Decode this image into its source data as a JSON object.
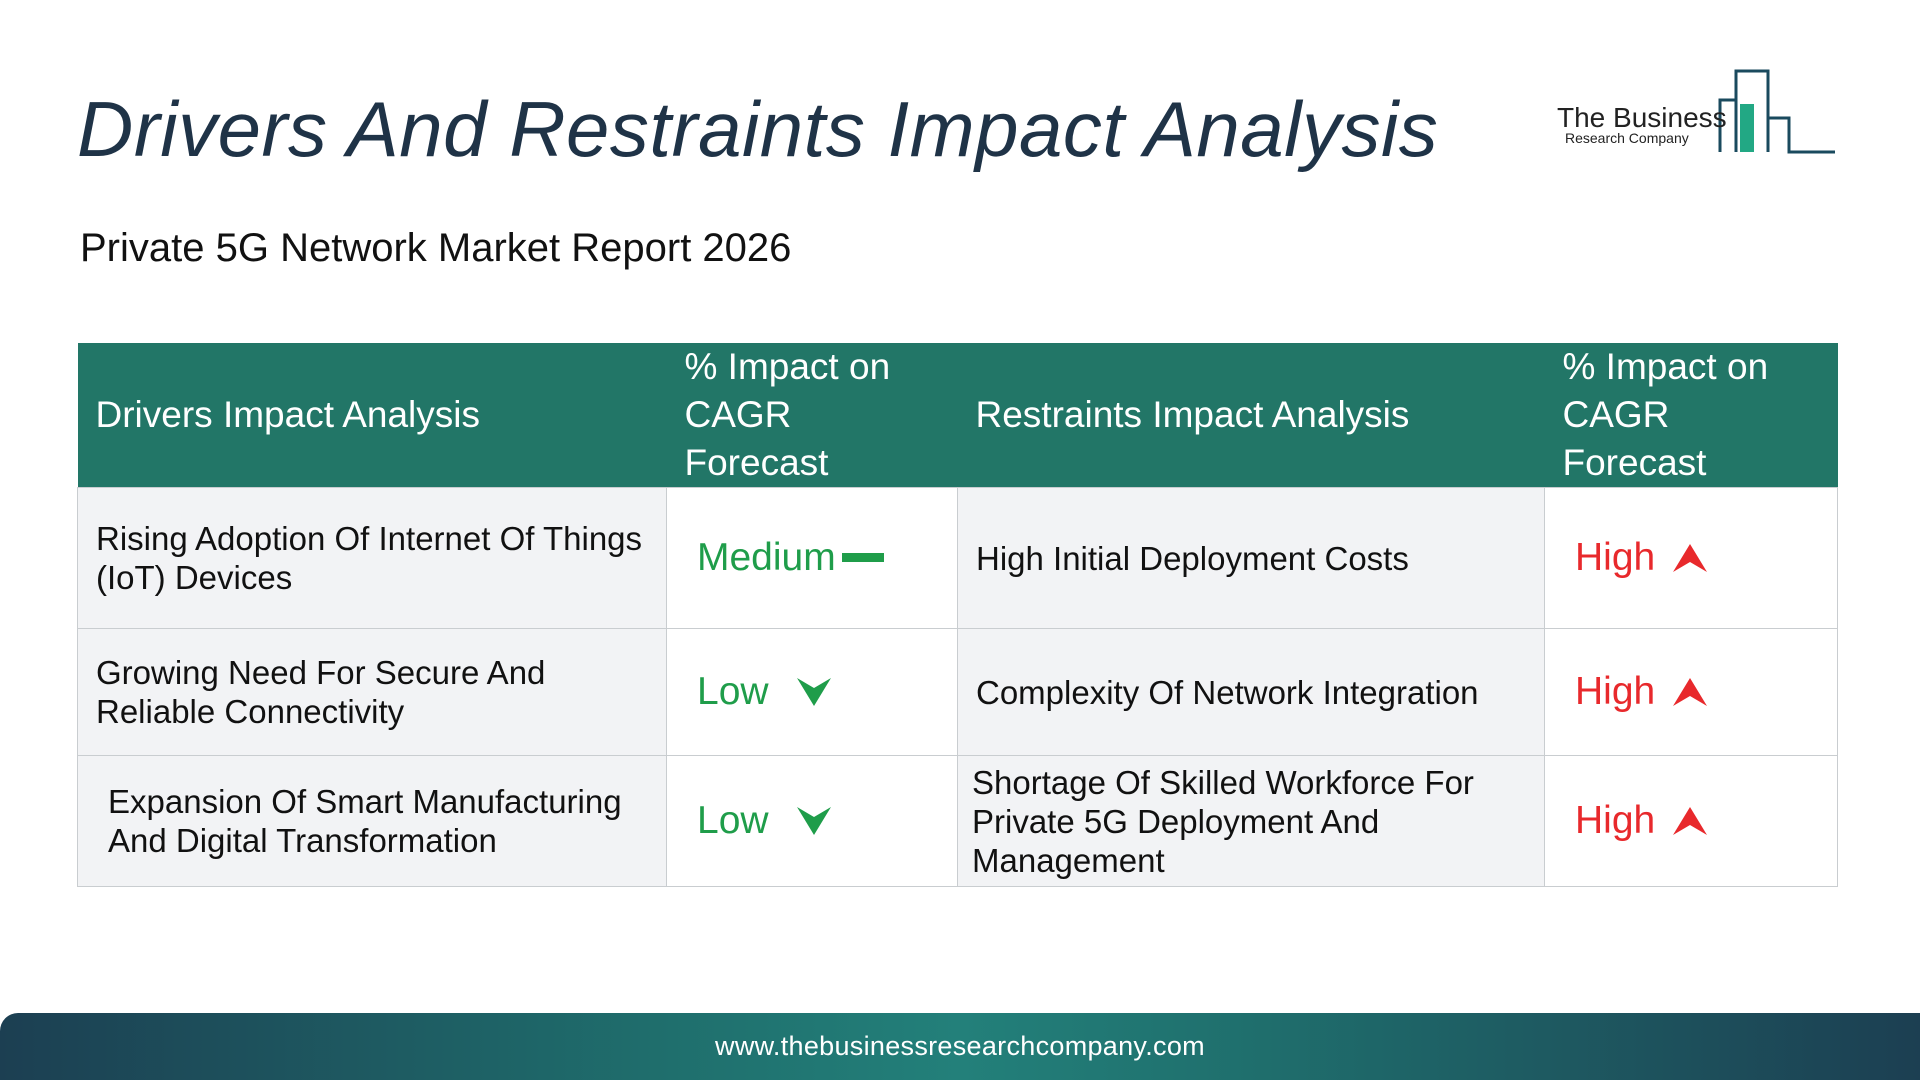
{
  "header": {
    "title": "Drivers And Restraints Impact Analysis",
    "subtitle": "Private 5G Network Market Report 2026"
  },
  "logo": {
    "name": "The Business",
    "sub": "Research Company"
  },
  "table": {
    "headers": [
      "Drivers Impact Analysis",
      "% Impact on CAGR Forecast",
      "Restraints Impact Analysis",
      "% Impact on CAGR Forecast"
    ],
    "rows": [
      {
        "driver": "Rising Adoption Of Internet Of Things (IoT) Devices",
        "driver_impact": "Medium",
        "driver_impact_icon": "dash-icon",
        "restraint": "High Initial Deployment Costs",
        "restraint_impact": "High",
        "restraint_impact_icon": "arrow-up-icon"
      },
      {
        "driver": "Growing Need For Secure And Reliable Connectivity",
        "driver_impact": "Low",
        "driver_impact_icon": "arrow-down-icon",
        "restraint": "Complexity Of Network Integration",
        "restraint_impact": "High",
        "restraint_impact_icon": "arrow-up-icon"
      },
      {
        "driver": "Expansion Of Smart Manufacturing And Digital Transformation",
        "driver_impact": "Low",
        "driver_impact_icon": "arrow-down-icon",
        "restraint": "Shortage Of Skilled Workforce For Private 5G Deployment And Management",
        "restraint_impact": "High",
        "restraint_impact_icon": "arrow-up-icon"
      }
    ]
  },
  "footer": {
    "url": "www.thebusinessresearchcompany.com"
  },
  "colors": {
    "header_bg": "#227667",
    "title": "#1f3347",
    "low_medium": "#1f9d4a",
    "high": "#e8292c"
  }
}
